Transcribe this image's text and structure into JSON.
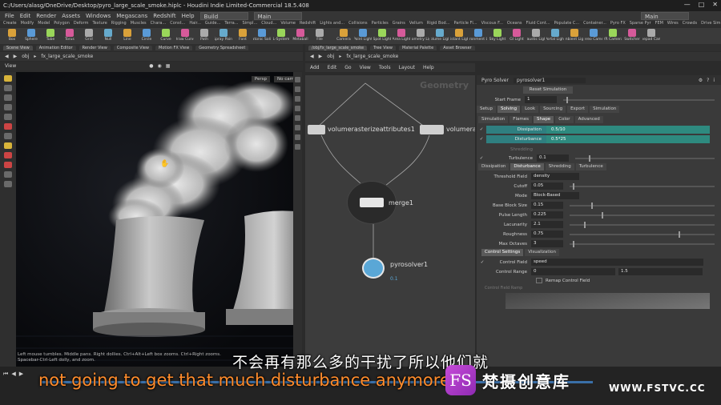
{
  "titlebar": {
    "title": "C:/Users/alasg/OneDrive/Desktop/pyro_large_scale_smoke.hiplc - Houdini Indie Limited-Commercial 18.5.408"
  },
  "menubar": {
    "items": [
      "File",
      "Edit",
      "Render",
      "Assets",
      "Windows",
      "Megascans",
      "Redshift",
      "Help"
    ],
    "desktop_left": "Build",
    "desktop_mid": "Main",
    "desktop_right": "Main"
  },
  "shelf_tabs": [
    "Create",
    "Modify",
    "Model",
    "Polygon",
    "Deform",
    "Texture",
    "Rigging",
    "Muscles",
    "Chara...",
    "Const...",
    "Hair...",
    "Guide...",
    "Terra...",
    "Simpl...",
    "Cloud...",
    "Volume",
    "Redshift",
    "Lights and...",
    "Collisions",
    "Particles",
    "Grains",
    "Vellum",
    "Rigid Bod...",
    "Particle Fl...",
    "Viscous F...",
    "Oceans",
    "Fluid Cont...",
    "Populate C...",
    "Container...",
    "Pyro FX",
    "Sparse Pyr",
    "FEM",
    "Wires",
    "Crowds",
    "Drive Sim..."
  ],
  "shelf_tools_left": [
    "Box",
    "Sphere",
    "Tube",
    "Torus",
    "Grid",
    "Null",
    "Line",
    "Circle",
    "Curve",
    "Draw Curve",
    "Path",
    "Spray Paint",
    "Font",
    "Platonic Solids",
    "L-System",
    "Metaball",
    "File"
  ],
  "shelf_tools_right": [
    "Camera",
    "Point Light",
    "Spot Light",
    "Area Light",
    "Geometry Light",
    "Volume Light",
    "Distant Light",
    "Environment Light",
    "Sky Light",
    "GI Light",
    "Caustic Light",
    "Portal Light",
    "Ambient Light",
    "Stereo Camera",
    "VR Camera",
    "Switcher",
    "Gamepad Camera"
  ],
  "left_panel": {
    "tabs": [
      "Scene View",
      "Animation Editor",
      "Render View",
      "Composite View",
      "Motion FX View",
      "Geometry Spreadsheet"
    ],
    "path": [
      "obj",
      "fx_large_scale_smoke"
    ],
    "view_label": "View",
    "persp": "Persp",
    "cam": "No cam",
    "status": "Left mouse tumbles. Middle pans. Right dollies. Ctrl+Alt+Left box zooms. Ctrl+Right zooms. Spacebar-Ctrl-Left dolly, and zoom."
  },
  "right_panel": {
    "tabs": [
      "/obj/fx_large_scale_smoke",
      "Tree View",
      "Material Palette",
      "Asset Browser"
    ],
    "path": [
      "obj",
      "fx_large_scale_smoke"
    ],
    "menu": [
      "Add",
      "Edit",
      "Go",
      "View",
      "Tools",
      "Layout",
      "Help"
    ],
    "network_type": "Geometry",
    "nodes": {
      "n1": "volumerasterizeattributes1",
      "n2": "volumeras",
      "merge": "merge1",
      "pyro": "pyrosolver1",
      "pyro_sub": "0.1"
    }
  },
  "params": {
    "node_type": "Pyro Solver",
    "node_name": "pyrosolver1",
    "reset": "Reset Simulation",
    "start_frame_label": "Start Frame",
    "start_frame": "1",
    "tabs": [
      "Setup",
      "Solving",
      "Look",
      "Sourcing",
      "Export",
      "Simulation"
    ],
    "subtabs": [
      "Simulation",
      "Flames",
      "Shape",
      "Color",
      "Advanced"
    ],
    "dissipation_label": "Dissipation",
    "dissipation": "0.5/10",
    "disturbance_label": "Disturbance",
    "disturbance": "0.5*25",
    "shredding_label": "Shredding",
    "turbulence_label": "Turbulence",
    "turbulence": "0.1",
    "shape_tabs": [
      "Dissipation",
      "Disturbance",
      "Shredding",
      "Turbulence"
    ],
    "rows": [
      {
        "label": "Threshold Field",
        "value": "density",
        "slider": null
      },
      {
        "label": "Cutoff",
        "value": "0.05",
        "slider": 0.02
      },
      {
        "label": "Mode",
        "value": "Block-Based",
        "slider": null
      },
      {
        "label": "Base Block Size",
        "value": "0.15",
        "slider": 0.15
      },
      {
        "label": "Pulse Length",
        "value": "0.225",
        "slider": 0.22
      },
      {
        "label": "Lacunarity",
        "value": "2.1",
        "slider": 0.1
      },
      {
        "label": "Roughness",
        "value": "0.75",
        "slider": 0.75
      },
      {
        "label": "Max Octaves",
        "value": "3",
        "slider": 0.02
      }
    ],
    "control_tabs": [
      "Control Settings",
      "Visualization"
    ],
    "control_field_label": "Control Field",
    "control_field": "speed",
    "control_range_label": "Control Range",
    "control_range_min": "0",
    "control_range_max": "1.5",
    "remap_label": "Remap Control Field",
    "ramp_label": "Control Field Ramp"
  },
  "subtitles": {
    "cn": "不会再有那么多的干扰了所以他们就",
    "en": "not going to get that much disturbance anymore"
  },
  "brand": {
    "logo": "FS",
    "name": "梵摄创意库",
    "site": "WWW.FSTVC.CC"
  },
  "colors": {
    "accent": "#2e8a7f",
    "subtitle_en": "#ff8c2c"
  }
}
